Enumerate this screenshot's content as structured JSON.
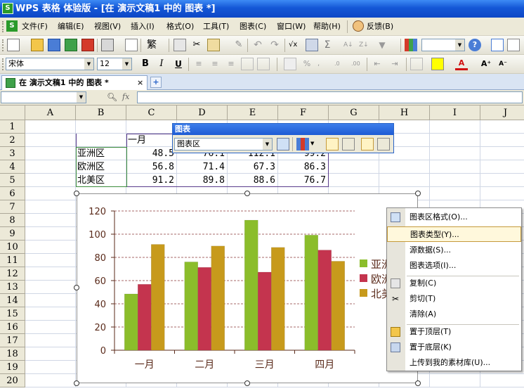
{
  "window": {
    "title": "WPS 表格 体验版 - [在 演示文稿1 中的 图表 *]",
    "app_icon": "S"
  },
  "menu": [
    "文件(F)",
    "编辑(E)",
    "视图(V)",
    "插入(I)",
    "格式(O)",
    "工具(T)",
    "图表(C)",
    "窗口(W)",
    "帮助(H)"
  ],
  "feedback_label": "反馈(B)",
  "format_bar": {
    "font": "宋体",
    "size": "12",
    "bold": "B",
    "italic": "I",
    "underline": "U"
  },
  "doc_tab": {
    "label": "在 演示文稿1 中的 图表 *",
    "close": "×",
    "new": "+"
  },
  "formula_bar": {
    "name_box": "",
    "fx": "fx",
    "value": ""
  },
  "columns": [
    "A",
    "B",
    "C",
    "D",
    "E",
    "F",
    "G",
    "H",
    "I",
    "J"
  ],
  "rows": [
    "1",
    "2",
    "3",
    "4",
    "5",
    "6",
    "7",
    "8",
    "9",
    "10",
    "11",
    "12",
    "13",
    "14",
    "15",
    "16",
    "17",
    "18",
    "19",
    "20"
  ],
  "sheet": {
    "header_c2": "一月",
    "regions": [
      "亚洲区",
      "欧洲区",
      "北美区"
    ],
    "values": [
      [
        "48.5",
        "76.1",
        "112.1",
        "99.2"
      ],
      [
        "56.8",
        "71.4",
        "67.3",
        "86.3"
      ],
      [
        "91.2",
        "89.8",
        "88.6",
        "76.7"
      ]
    ]
  },
  "chart_toolbar": {
    "title": "图表",
    "selector": "图表区"
  },
  "context_menu": {
    "items": [
      "图表区格式(O)...",
      "图表类型(Y)...",
      "源数据(S)...",
      "图表选项(I)...",
      "复制(C)",
      "剪切(T)",
      "清除(A)",
      "置于顶层(T)",
      "置于底层(K)",
      "上传到我的素材库(U)..."
    ],
    "highlighted_index": 1
  },
  "chart_data": {
    "type": "bar",
    "categories": [
      "一月",
      "二月",
      "三月",
      "四月"
    ],
    "series": [
      {
        "name": "亚洲区",
        "values": [
          48.5,
          76.1,
          112.1,
          99.2
        ],
        "color": "#8bbd2b"
      },
      {
        "name": "欧洲区",
        "values": [
          56.8,
          71.4,
          67.3,
          86.3
        ],
        "color": "#c4344e"
      },
      {
        "name": "北美区",
        "values": [
          91.2,
          89.8,
          88.6,
          76.7
        ],
        "color": "#c79a1c"
      }
    ],
    "yticks": [
      "0",
      "20",
      "40",
      "60",
      "80",
      "100",
      "120"
    ],
    "ylim": [
      0,
      120
    ],
    "legend_labels": [
      "亚洲",
      "欧洲",
      "北美"
    ],
    "grid": true,
    "legend": "right"
  }
}
